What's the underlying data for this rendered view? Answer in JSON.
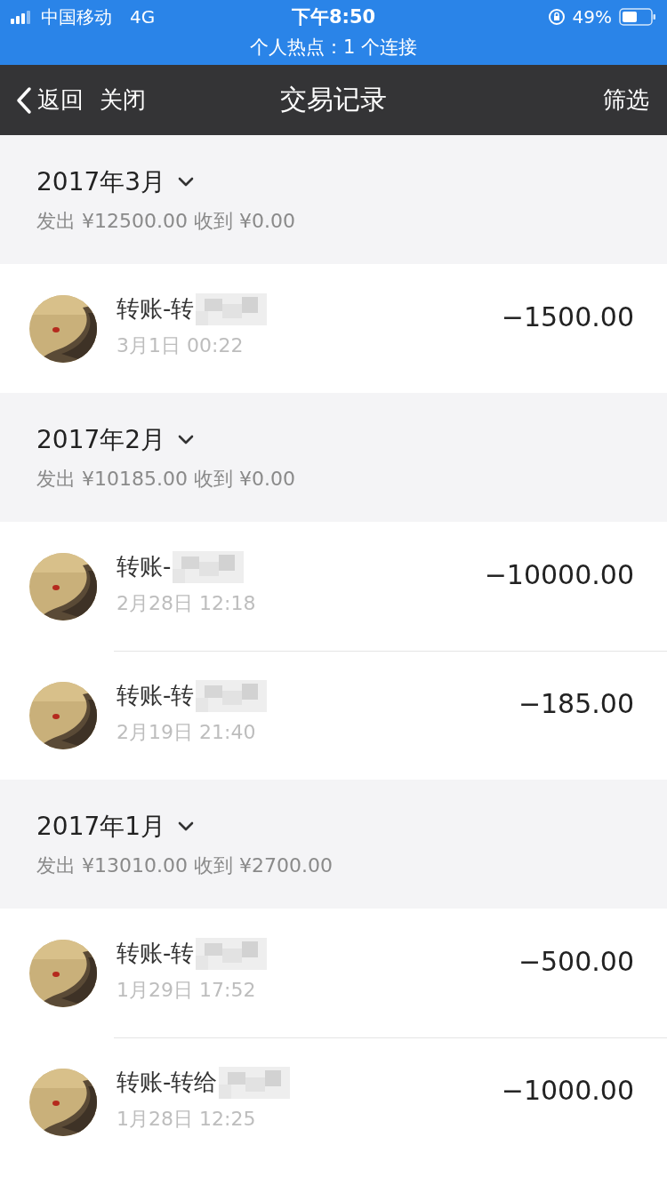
{
  "status_bar": {
    "carrier": "中国移动",
    "network": "4G",
    "time": "下午8:50",
    "battery": "49%",
    "hotspot": "个人热点：1 个连接"
  },
  "nav": {
    "back": "返回",
    "close": "关闭",
    "title": "交易记录",
    "filter": "筛选"
  },
  "groups": [
    {
      "month": "2017年3月",
      "summary": "发出 ¥12500.00 收到 ¥0.00",
      "rows": [
        {
          "title": "转账-转",
          "date": "3月1日 00:22",
          "amount": "−1500.00"
        }
      ]
    },
    {
      "month": "2017年2月",
      "summary": "发出 ¥10185.00 收到 ¥0.00",
      "rows": [
        {
          "title": "转账-",
          "date": "2月28日 12:18",
          "amount": "−10000.00"
        },
        {
          "title": "转账-转",
          "date": "2月19日 21:40",
          "amount": "−185.00"
        }
      ]
    },
    {
      "month": "2017年1月",
      "summary": "发出 ¥13010.00 收到 ¥2700.00",
      "rows": [
        {
          "title": "转账-转",
          "date": "1月29日 17:52",
          "amount": "−500.00"
        },
        {
          "title": "转账-转给",
          "date": "1月28日 12:25",
          "amount": "−1000.00"
        }
      ]
    }
  ]
}
